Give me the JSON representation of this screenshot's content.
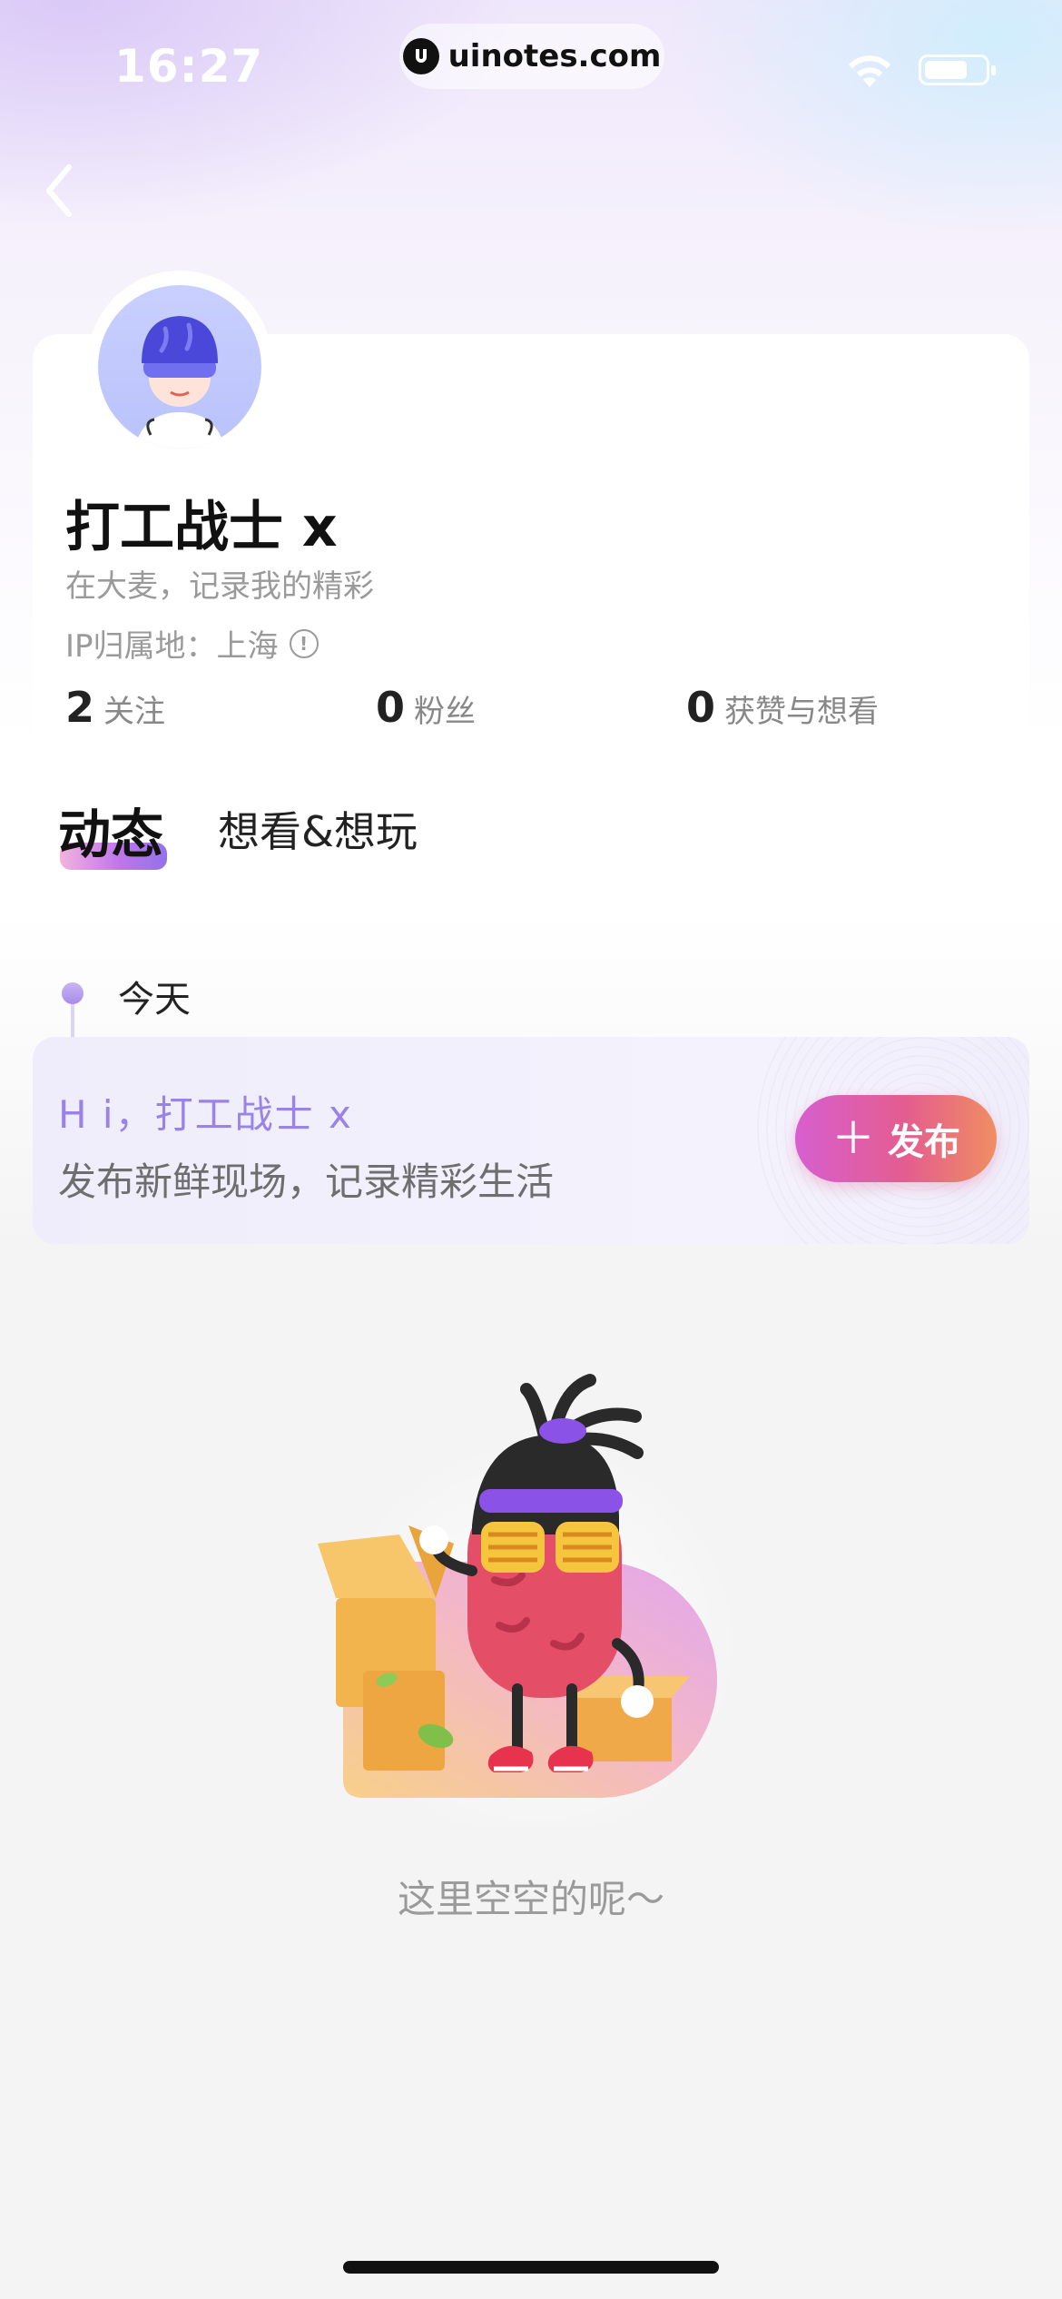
{
  "status_bar": {
    "time": "16:27",
    "url": "uinotes.com",
    "icons": [
      "wifi-icon",
      "battery-icon"
    ]
  },
  "nav": {
    "back_icon": "chevron-left-icon"
  },
  "profile": {
    "name": "打工战士 x",
    "bio": "在大麦，记录我的精彩",
    "ip_location": "IP归属地：上海",
    "stats": [
      {
        "value": "2",
        "label": "关注"
      },
      {
        "value": "0",
        "label": "粉丝"
      },
      {
        "value": "0",
        "label": "获赞与想看"
      }
    ]
  },
  "tabs": [
    {
      "label": "动态",
      "active": true
    },
    {
      "label": "想看&想玩",
      "active": false
    }
  ],
  "timeline": {
    "label": "今天"
  },
  "publish_card": {
    "greeting": "H i，打工战士 x",
    "subtitle": "发布新鲜现场，记录精彩生活",
    "button_label": "发布"
  },
  "empty_state": {
    "text": "这里空空的呢～"
  },
  "colors": {
    "accent_purple": "#9a83e6",
    "publish_gradient_start": "#d75fd0",
    "publish_gradient_end": "#f08e62"
  }
}
